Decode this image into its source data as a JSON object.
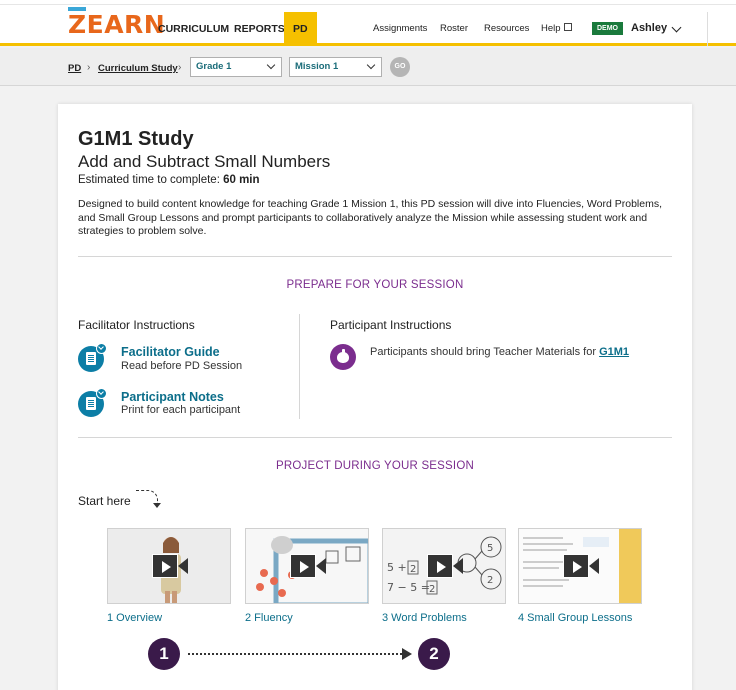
{
  "nav": {
    "logo": "ZEARN",
    "items": [
      "CURRICULUM",
      "REPORTS",
      "PD"
    ],
    "right_items": [
      "Assignments",
      "Roster",
      "Resources",
      "Help"
    ],
    "demo_badge": "DEMO",
    "user": "Ashley"
  },
  "breadcrumb": {
    "root": "PD",
    "section": "Curriculum Study",
    "grade_select": "Grade 1",
    "mission_select": "Mission 1",
    "go": "GO"
  },
  "study": {
    "title": "G1M1 Study",
    "subtitle": "Add and Subtract Small Numbers",
    "est_label": "Estimated time to complete: ",
    "est_value": "60 min",
    "description": "Designed to build content knowledge for teaching Grade 1 Mission 1, this PD session will dive into Fluencies, Word Problems, and Small Group Lessons and prompt participants to collaboratively analyze the Mission while assessing student work and strategies to problem solve."
  },
  "prepare": {
    "heading": "PREPARE FOR YOUR SESSION",
    "facilitator_heading": "Facilitator Instructions",
    "participant_heading": "Participant Instructions",
    "resources": [
      {
        "title": "Facilitator Guide",
        "note": "Read before PD Session"
      },
      {
        "title": "Participant Notes",
        "note": "Print for each participant"
      }
    ],
    "participant_note": "Participants should bring Teacher Materials for ",
    "participant_link": "G1M1"
  },
  "project": {
    "heading": "PROJECT DURING YOUR SESSION",
    "start_here": "Start here",
    "videos": [
      {
        "label": "1 Overview"
      },
      {
        "label": "2 Fluency"
      },
      {
        "label": "3 Word Problems"
      },
      {
        "label": "4 Small Group Lessons"
      }
    ],
    "steps": [
      "1",
      "2"
    ]
  },
  "colors": {
    "accent_yellow": "#f5c000",
    "logo_orange": "#e8671b",
    "link_teal": "#0c6e8a",
    "section_purple": "#7b2d8e",
    "step_dark": "#3a1a4a",
    "demo_green": "#1a7a3c"
  }
}
